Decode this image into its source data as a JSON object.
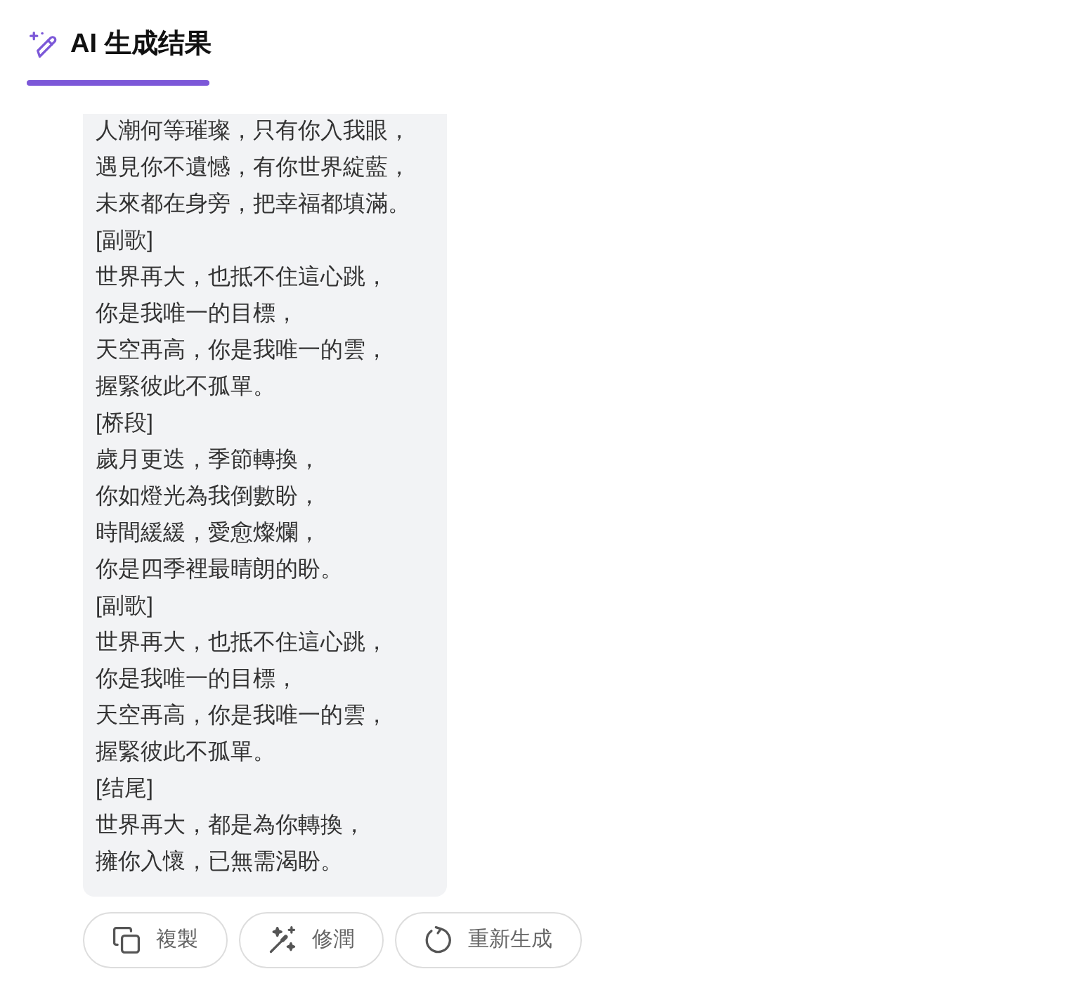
{
  "tab": {
    "label": "AI 生成结果",
    "selected": true
  },
  "lyrics": {
    "lines": [
      "人潮何等璀璨，只有你入我眼，",
      "遇見你不遺憾，有你世界綻藍，",
      "未來都在身旁，把幸福都填滿。",
      "[副歌]",
      "世界再大，也抵不住這心跳，",
      "你是我唯一的目標，",
      "天空再高，你是我唯一的雲，",
      "握緊彼此不孤單。",
      "[桥段]",
      "歲月更迭，季節轉換，",
      "你如燈光為我倒數盼，",
      "時間緩緩，愛愈燦爛，",
      "你是四季裡最晴朗的盼。",
      "[副歌]",
      "世界再大，也抵不住這心跳，",
      "你是我唯一的目標，",
      "天空再高，你是我唯一的雲，",
      "握緊彼此不孤單。",
      "[结尾]",
      "世界再大，都是為你轉換，",
      "擁你入懷，已無需渴盼。"
    ]
  },
  "actions": [
    {
      "kind": "copy",
      "label": "複製"
    },
    {
      "kind": "polish",
      "label": "修潤"
    },
    {
      "kind": "regenerate",
      "label": "重新生成"
    }
  ]
}
